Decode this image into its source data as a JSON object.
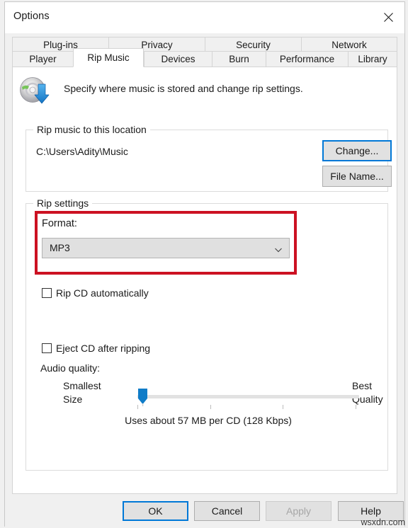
{
  "window": {
    "title": "Options",
    "close_icon": "close-icon"
  },
  "tabs": {
    "row1": [
      {
        "label": "Plug-ins",
        "active": false
      },
      {
        "label": "Privacy",
        "active": false
      },
      {
        "label": "Security",
        "active": false
      },
      {
        "label": "Network",
        "active": false
      }
    ],
    "row2": [
      {
        "label": "Player",
        "active": false
      },
      {
        "label": "Rip Music",
        "active": true
      },
      {
        "label": "Devices",
        "active": false
      },
      {
        "label": "Burn",
        "active": false
      },
      {
        "label": "Performance",
        "active": false
      },
      {
        "label": "Library",
        "active": false
      }
    ]
  },
  "header": {
    "icon": "cd-rip-icon",
    "description": "Specify where music is stored and change rip settings."
  },
  "location_group": {
    "title": "Rip music to this location",
    "path": "C:\\Users\\Adity\\Music",
    "change_button": "Change...",
    "filename_button": "File Name..."
  },
  "rip_settings": {
    "title": "Rip settings",
    "format_label": "Format:",
    "format_value": "MP3",
    "format_dropdown_icon": "chevron-down-icon",
    "rip_auto_label": "Rip CD automatically",
    "rip_auto_checked": false,
    "eject_label": "Eject CD after ripping",
    "eject_checked": false,
    "audio_quality_label": "Audio quality:",
    "slider_min_label": "Smallest\nSize",
    "slider_min_line1": "Smallest",
    "slider_min_line2": "Size",
    "slider_max_line1": "Best",
    "slider_max_line2": "Quality",
    "slider_note": "Uses about 57 MB per CD (128 Kbps)",
    "slider_value_percent": 0
  },
  "annotation": {
    "type": "red-rectangle-highlight",
    "color": "#cc1122",
    "targets": "format-section"
  },
  "footer": {
    "ok": "OK",
    "cancel": "Cancel",
    "apply": "Apply",
    "help": "Help",
    "apply_disabled": true,
    "ok_focused": true
  },
  "watermark": "wsxdn.com",
  "colors": {
    "accent": "#0078d7",
    "annotation_red": "#cc1122",
    "window_bg": "#f0f0f0",
    "pane_bg": "#ffffff",
    "button_bg": "#e1e1e1"
  }
}
